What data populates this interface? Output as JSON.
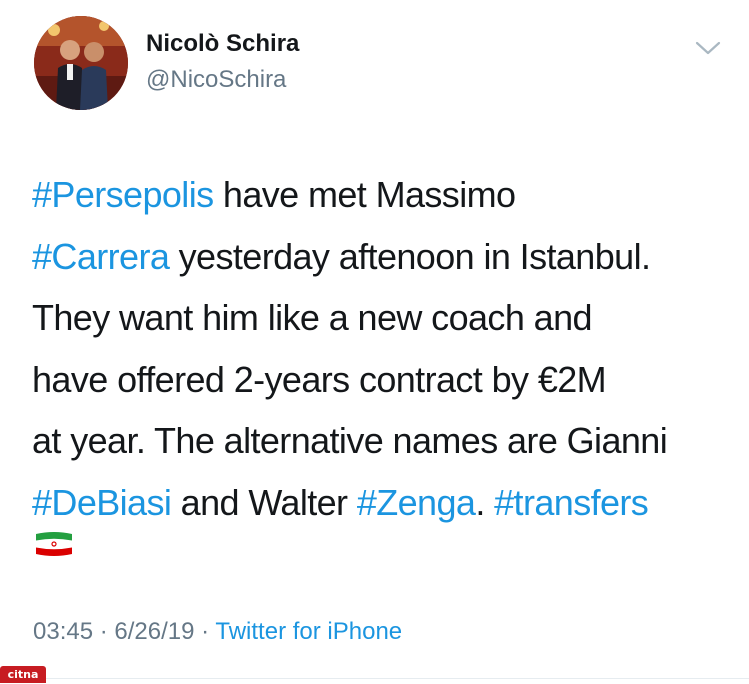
{
  "tweet": {
    "author": {
      "display_name": "Nicolò Schira",
      "handle": "@NicoSchira",
      "avatar_icon": "profile-photo"
    },
    "menu_icon": "chevron-down-icon",
    "text_lines": [
      [
        {
          "t": "#Persepolis",
          "tag": true
        },
        {
          "t": " have met Massimo",
          "tag": false
        }
      ],
      [
        {
          "t": "#Carrera",
          "tag": true
        },
        {
          "t": " yesterday aftenoon in Istanbul.",
          "tag": false
        }
      ],
      [
        {
          "t": "They want him like a new coach and",
          "tag": false
        }
      ],
      [
        {
          "t": "have offered 2-years contract by €2M",
          "tag": false
        }
      ],
      [
        {
          "t": "at year. The alternative names are Gianni",
          "tag": false
        }
      ],
      [
        {
          "t": "#DeBiasi",
          "tag": true
        },
        {
          "t": " and Walter ",
          "tag": false
        },
        {
          "t": "#Zenga",
          "tag": true
        },
        {
          "t": ". ",
          "tag": false
        },
        {
          "t": "#transfers",
          "tag": true
        }
      ]
    ],
    "emoji": "iran-flag-icon",
    "time": "03:45",
    "date": "6/26/19",
    "separator": "·",
    "source": "Twitter for iPhone"
  },
  "watermark": "CITNA",
  "colors": {
    "hashtag": "#1b95e0",
    "text": "#14171a",
    "secondary": "#657786",
    "watermark_bg": "#c71c22"
  }
}
